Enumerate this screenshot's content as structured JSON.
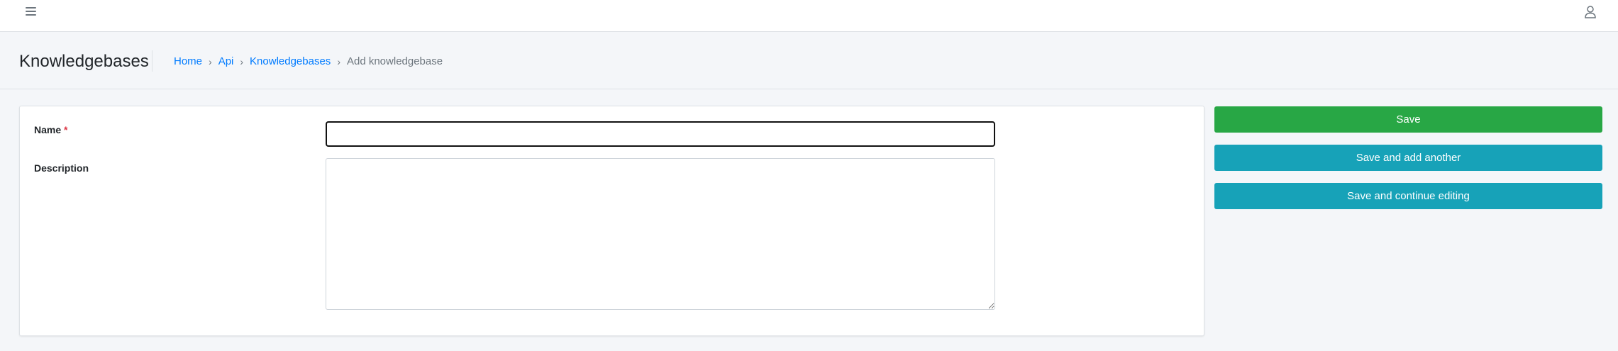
{
  "topbar": {
    "menu_icon": "hamburger-menu-icon",
    "user_icon": "user-icon"
  },
  "header": {
    "title": "Knowledgebases",
    "breadcrumb": [
      {
        "label": "Home"
      },
      {
        "label": "Api"
      },
      {
        "label": "Knowledgebases"
      },
      {
        "label": "Add knowledgebase"
      }
    ],
    "separator": "›"
  },
  "form": {
    "name_label": "Name",
    "required_mark": "*",
    "name_value": "",
    "description_label": "Description",
    "description_value": ""
  },
  "actions": {
    "save": "Save",
    "save_add_another": "Save and add another",
    "save_continue": "Save and continue editing"
  },
  "colors": {
    "save": "#28a745",
    "secondary": "#17a2b8",
    "link": "#007bff",
    "required": "#dc3545"
  }
}
